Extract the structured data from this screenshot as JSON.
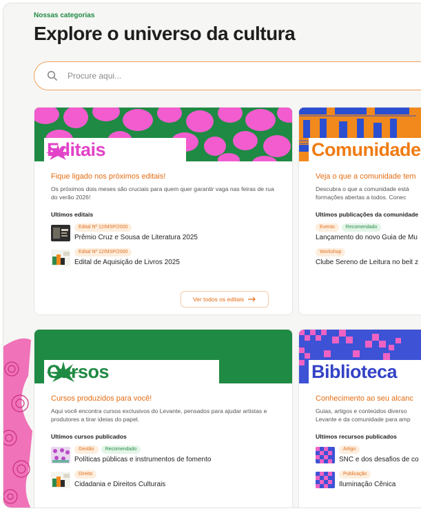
{
  "header": {
    "eyebrow": "Nossas categorias",
    "title": "Explore o universo da cultura"
  },
  "search": {
    "placeholder": "Procure aqui...",
    "icon": "search-icon"
  },
  "colors": {
    "accent_orange": "#e36c12",
    "accent_green": "#1f8a43",
    "banner_pink": "#f25ccf",
    "banner_green": "#1f8a43",
    "banner_orange": "#f2891c",
    "banner_blue": "#3d52d5"
  },
  "cards": [
    {
      "title": "Editais",
      "tagline": "Fique ligado nos próximos editais!",
      "description": "Os próximos dois meses são cruciais para quem quer garantir vaga nas feiras de rua do verão 2026!",
      "list_title": "Ultimos editais",
      "items": [
        {
          "pills": [
            "Edital Nº 12/MSP/2000"
          ],
          "name": "Prêmio Cruz e Sousa de Literatura 2025"
        },
        {
          "pills": [
            "Edital Nº 12/MSP/2000"
          ],
          "name": "Edital de Aquisição de Livros 2025"
        }
      ],
      "more_label": "Ver todos os editais",
      "more_icon": "arrow-right-icon"
    },
    {
      "title": "Comunidade",
      "tagline": "Veja o que a comunidade tem",
      "description": "Descubra o que a comunidade está formações abertas a todos. Conec",
      "list_title": "Ultimos publicações da comunidade",
      "items": [
        {
          "pills": [
            "Evento",
            "Recomendado"
          ],
          "name": "Lançamento do novo Guia de Mu"
        },
        {
          "pills": [
            "Workshop"
          ],
          "name": "Clube Sereno de Leitura no beit z"
        }
      ]
    },
    {
      "title": "Cursos",
      "tagline": "Cursos produzidos para você!",
      "description": "Aqui você encontra cursos exclusivos do Levante, pensados para ajudar artistas e produtores a tirar ideias do papel.",
      "list_title": "Ultimos cursos publicados",
      "items": [
        {
          "pills": [
            "Gestão",
            "Recomendado"
          ],
          "name": "Políticas públicas e instrumentos de fomento"
        },
        {
          "pills": [
            "Direito"
          ],
          "name": "Cidadania e Direitos Culturais"
        }
      ]
    },
    {
      "title": "Biblioteca",
      "tagline": "Conhecimento ao seu alcanc",
      "description": "Guias, artigos e conteúdos diverso Levante e da comunidade para amp",
      "list_title": "Ultimos recursos publicados",
      "items": [
        {
          "pills": [
            "Artigo"
          ],
          "name": "SNC e dos desafios de co"
        },
        {
          "pills": [
            "Publicação"
          ],
          "name": "Iluminação Cênica"
        }
      ]
    }
  ]
}
